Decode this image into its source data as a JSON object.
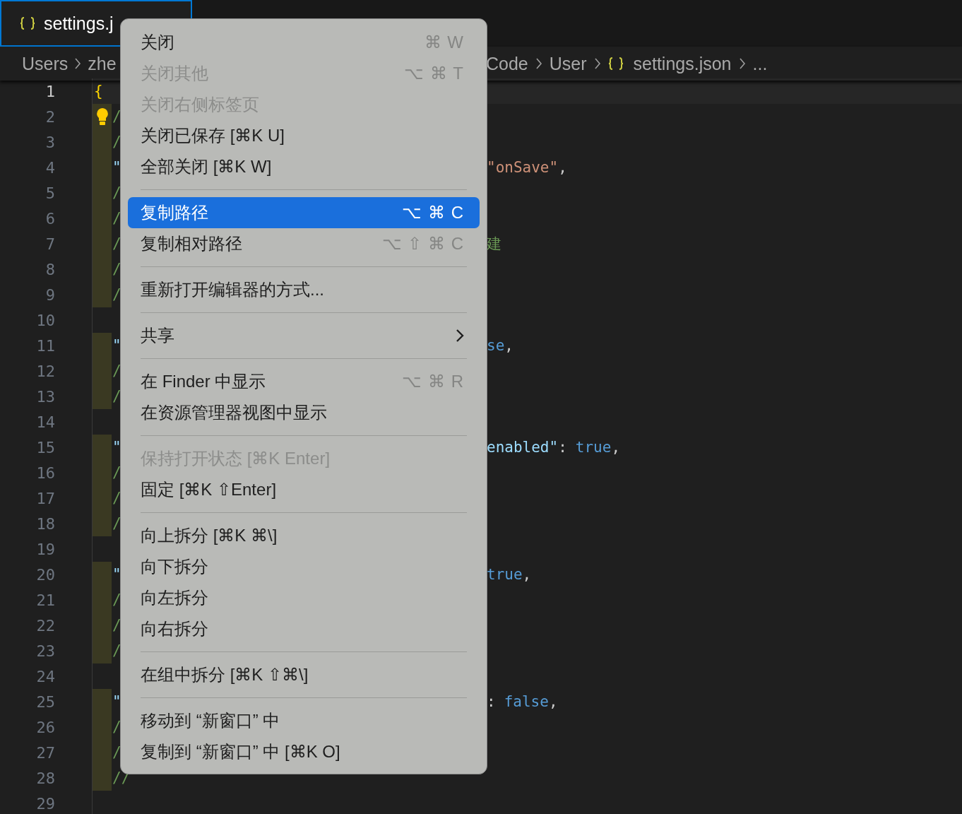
{
  "tab": {
    "label": "settings.j",
    "selected": true
  },
  "breadcrumbs": {
    "left": [
      "Users",
      "zhe"
    ],
    "right": [
      {
        "label": "Code",
        "json_icon": false
      },
      {
        "label": "User",
        "json_icon": false
      },
      {
        "label": "settings.json",
        "json_icon": true
      },
      {
        "label": "...",
        "json_icon": false
      }
    ]
  },
  "editor": {
    "lines": [
      {
        "number": "1",
        "active": true,
        "highlighted": false,
        "lightbulb": false,
        "left": [
          {
            "kind": "brace",
            "text": "{"
          }
        ]
      },
      {
        "number": "2",
        "active": false,
        "highlighted": true,
        "lightbulb": true,
        "left": [
          {
            "kind": "comment",
            "text": "/"
          }
        ]
      },
      {
        "number": "3",
        "active": false,
        "highlighted": true,
        "lightbulb": false,
        "left": [
          {
            "kind": "comment",
            "text": "/"
          }
        ]
      },
      {
        "number": "4",
        "active": false,
        "highlighted": true,
        "lightbulb": false,
        "left": [
          {
            "kind": "key",
            "text": "\""
          }
        ],
        "right": [
          {
            "kind": "string",
            "text": "\"onSave\""
          },
          {
            "kind": "punct",
            "text": ","
          }
        ]
      },
      {
        "number": "5",
        "active": false,
        "highlighted": true,
        "lightbulb": false,
        "left": [
          {
            "kind": "comment",
            "text": "/"
          }
        ]
      },
      {
        "number": "6",
        "active": false,
        "highlighted": true,
        "lightbulb": false,
        "left": [
          {
            "kind": "comment",
            "text": "/"
          }
        ]
      },
      {
        "number": "7",
        "active": false,
        "highlighted": true,
        "lightbulb": false,
        "left": [
          {
            "kind": "comment",
            "text": "/"
          }
        ],
        "right": [
          {
            "kind": "comment",
            "text": "建"
          }
        ]
      },
      {
        "number": "8",
        "active": false,
        "highlighted": true,
        "lightbulb": false,
        "left": [
          {
            "kind": "comment",
            "text": "/"
          }
        ]
      },
      {
        "number": "9",
        "active": false,
        "highlighted": true,
        "lightbulb": false,
        "left": [
          {
            "kind": "comment",
            "text": "/"
          }
        ]
      },
      {
        "number": "10",
        "active": false,
        "highlighted": false,
        "lightbulb": false
      },
      {
        "number": "11",
        "active": false,
        "highlighted": true,
        "lightbulb": false,
        "left": [
          {
            "kind": "key",
            "text": "\""
          }
        ],
        "right": [
          {
            "kind": "bool",
            "text": "se"
          },
          {
            "kind": "punct",
            "text": ","
          }
        ]
      },
      {
        "number": "12",
        "active": false,
        "highlighted": true,
        "lightbulb": false,
        "left": [
          {
            "kind": "comment",
            "text": "/"
          }
        ]
      },
      {
        "number": "13",
        "active": false,
        "highlighted": true,
        "lightbulb": false,
        "left": [
          {
            "kind": "comment",
            "text": "/"
          }
        ]
      },
      {
        "number": "14",
        "active": false,
        "highlighted": false,
        "lightbulb": false
      },
      {
        "number": "15",
        "active": false,
        "highlighted": true,
        "lightbulb": false,
        "left": [
          {
            "kind": "key",
            "text": "\""
          }
        ],
        "right": [
          {
            "kind": "key",
            "text": "enabled\""
          },
          {
            "kind": "punct",
            "text": ":"
          },
          {
            "kind": "bool",
            "text": "true"
          },
          {
            "kind": "punct",
            "text": ","
          }
        ]
      },
      {
        "number": "16",
        "active": false,
        "highlighted": true,
        "lightbulb": false,
        "left": [
          {
            "kind": "comment",
            "text": "/"
          }
        ]
      },
      {
        "number": "17",
        "active": false,
        "highlighted": true,
        "lightbulb": false,
        "left": [
          {
            "kind": "comment",
            "text": "/"
          }
        ]
      },
      {
        "number": "18",
        "active": false,
        "highlighted": true,
        "lightbulb": false,
        "left": [
          {
            "kind": "comment",
            "text": "/"
          }
        ]
      },
      {
        "number": "19",
        "active": false,
        "highlighted": false,
        "lightbulb": false
      },
      {
        "number": "20",
        "active": false,
        "highlighted": true,
        "lightbulb": false,
        "left": [
          {
            "kind": "key",
            "text": "\""
          }
        ],
        "right": [
          {
            "kind": "bool",
            "text": "true"
          },
          {
            "kind": "punct",
            "text": ","
          }
        ]
      },
      {
        "number": "21",
        "active": false,
        "highlighted": true,
        "lightbulb": false,
        "left": [
          {
            "kind": "comment",
            "text": "/"
          }
        ]
      },
      {
        "number": "22",
        "active": false,
        "highlighted": true,
        "lightbulb": false,
        "left": [
          {
            "kind": "comment",
            "text": "/"
          }
        ]
      },
      {
        "number": "23",
        "active": false,
        "highlighted": true,
        "lightbulb": false,
        "left": [
          {
            "kind": "comment",
            "text": "/"
          }
        ]
      },
      {
        "number": "24",
        "active": false,
        "highlighted": false,
        "lightbulb": false
      },
      {
        "number": "25",
        "active": false,
        "highlighted": true,
        "lightbulb": false,
        "left": [
          {
            "kind": "key",
            "text": "\""
          }
        ],
        "right": [
          {
            "kind": "punct",
            "text": ":"
          },
          {
            "kind": "bool",
            "text": "false"
          },
          {
            "kind": "punct",
            "text": ","
          }
        ]
      },
      {
        "number": "26",
        "active": false,
        "highlighted": true,
        "lightbulb": false,
        "left": [
          {
            "kind": "comment",
            "text": "/"
          }
        ]
      },
      {
        "number": "27",
        "active": false,
        "highlighted": true,
        "lightbulb": false,
        "left": [
          {
            "kind": "comment",
            "text": "/"
          }
        ]
      },
      {
        "number": "28",
        "active": false,
        "highlighted": true,
        "lightbulb": false,
        "left": [
          {
            "kind": "comment",
            "text": "//"
          }
        ]
      },
      {
        "number": "29",
        "active": false,
        "highlighted": false,
        "lightbulb": false
      }
    ]
  },
  "context_menu": {
    "items": [
      {
        "kind": "item",
        "label": "关闭",
        "shortcut": "⌘ W",
        "disabled": false,
        "selected": false
      },
      {
        "kind": "item",
        "label": "关闭其他",
        "shortcut": "⌥ ⌘ T",
        "disabled": true,
        "selected": false
      },
      {
        "kind": "item",
        "label": "关闭右侧标签页",
        "disabled": true,
        "selected": false
      },
      {
        "kind": "item",
        "label": "关闭已保存 [⌘K U]",
        "disabled": false,
        "selected": false
      },
      {
        "kind": "item",
        "label": "全部关闭 [⌘K W]",
        "disabled": false,
        "selected": false
      },
      {
        "kind": "separator"
      },
      {
        "kind": "item",
        "label": "复制路径",
        "shortcut": "⌥ ⌘ C",
        "disabled": false,
        "selected": true
      },
      {
        "kind": "item",
        "label": "复制相对路径",
        "shortcut": "⌥ ⇧ ⌘ C",
        "disabled": false,
        "selected": false
      },
      {
        "kind": "separator"
      },
      {
        "kind": "item",
        "label": "重新打开编辑器的方式...",
        "disabled": false,
        "selected": false
      },
      {
        "kind": "separator"
      },
      {
        "kind": "submenu",
        "label": "共享",
        "disabled": false,
        "selected": false
      },
      {
        "kind": "separator"
      },
      {
        "kind": "item",
        "label": "在 Finder 中显示",
        "shortcut": "⌥ ⌘ R",
        "disabled": false,
        "selected": false
      },
      {
        "kind": "item",
        "label": "在资源管理器视图中显示",
        "disabled": false,
        "selected": false
      },
      {
        "kind": "separator"
      },
      {
        "kind": "item",
        "label": "保持打开状态 [⌘K Enter]",
        "disabled": true,
        "selected": false
      },
      {
        "kind": "item",
        "label": "固定 [⌘K ⇧Enter]",
        "disabled": false,
        "selected": false
      },
      {
        "kind": "separator"
      },
      {
        "kind": "item",
        "label": "向上拆分 [⌘K ⌘\\]",
        "disabled": false,
        "selected": false
      },
      {
        "kind": "item",
        "label": "向下拆分",
        "disabled": false,
        "selected": false
      },
      {
        "kind": "item",
        "label": "向左拆分",
        "disabled": false,
        "selected": false
      },
      {
        "kind": "item",
        "label": "向右拆分",
        "disabled": false,
        "selected": false
      },
      {
        "kind": "separator"
      },
      {
        "kind": "item",
        "label": "在组中拆分 [⌘K ⇧⌘\\]",
        "disabled": false,
        "selected": false
      },
      {
        "kind": "separator"
      },
      {
        "kind": "item",
        "label": "移动到 “新窗口” 中",
        "disabled": false,
        "selected": false
      },
      {
        "kind": "item",
        "label": "复制到 “新窗口” 中 [⌘K O]",
        "disabled": false,
        "selected": false
      }
    ]
  }
}
